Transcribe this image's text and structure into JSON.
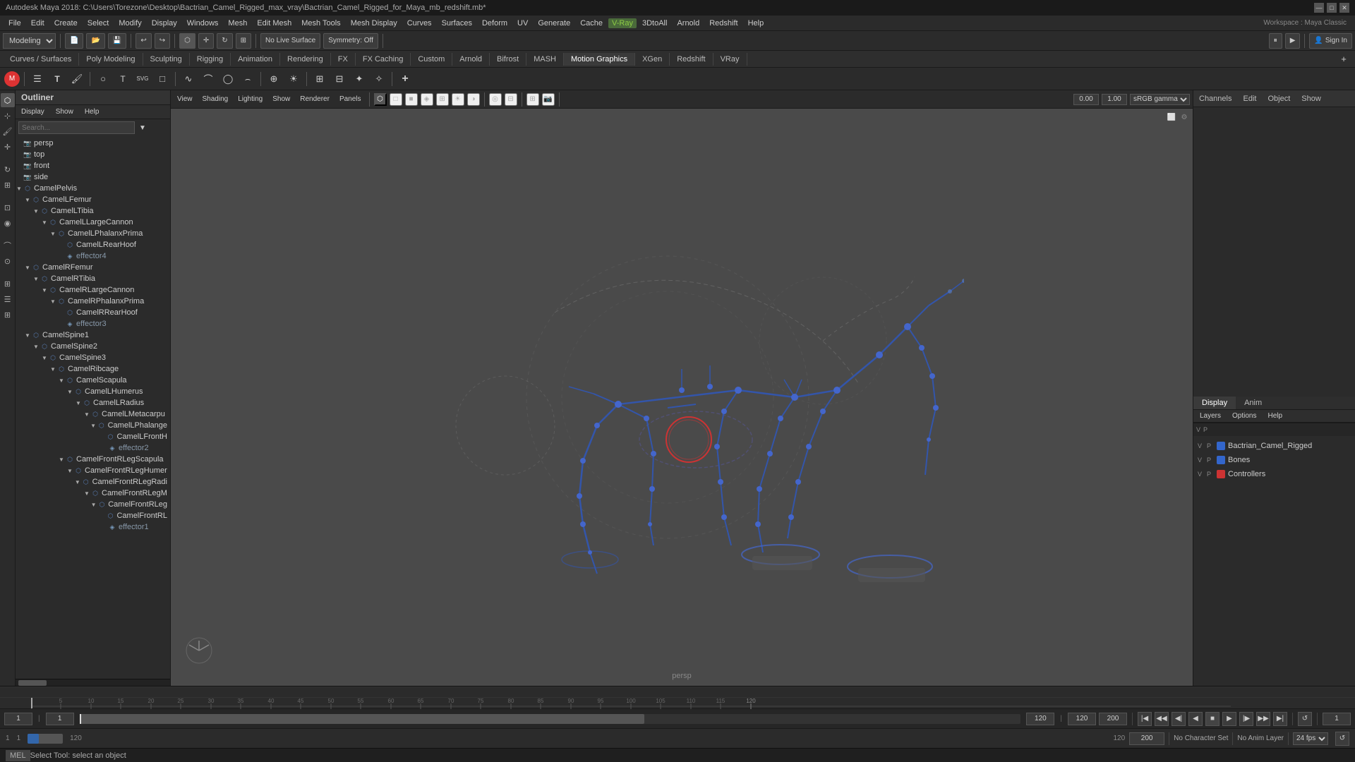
{
  "titleBar": {
    "title": "Autodesk Maya 2018: C:\\Users\\Torezone\\Desktop\\Bactrian_Camel_Rigged_max_vray\\Bactrian_Camel_Rigged_for_Maya_mb_redshift.mb*",
    "controls": [
      "—",
      "□",
      "✕"
    ]
  },
  "menuBar": {
    "items": [
      "File",
      "Edit",
      "Create",
      "Select",
      "Modify",
      "Display",
      "Windows",
      "Mesh",
      "Edit Mesh",
      "Mesh Tools",
      "Mesh Display",
      "Curves",
      "Surfaces",
      "Deform",
      "UV",
      "Generate",
      "Cache",
      "V-Ray",
      "3DtoAll",
      "Arnold",
      "Redshift",
      "Help"
    ]
  },
  "toolbar1": {
    "modeLabel": "Modeling",
    "workspaceLabel": "Workspace : Maya Classic",
    "liveSurface": "No Live Surface",
    "symmetry": "Symmetry: Off",
    "signIn": "Sign In"
  },
  "toolbar2": {
    "tabs": [
      "Curves / Surfaces",
      "Poly Modeling",
      "Sculpting",
      "Rigging",
      "Animation",
      "Rendering",
      "FX",
      "FX Caching",
      "Custom",
      "Arnold",
      "Bifrost",
      "MASH",
      "Motion Graphics",
      "XGen",
      "Redshift",
      "VRay"
    ]
  },
  "outliner": {
    "title": "Outliner",
    "menuItems": [
      "Display",
      "Show",
      "Help"
    ],
    "searchPlaceholder": "Search...",
    "items": [
      {
        "id": "persp",
        "label": "persp",
        "depth": 0,
        "type": "camera",
        "hasArrow": false
      },
      {
        "id": "top",
        "label": "top",
        "depth": 0,
        "type": "camera",
        "hasArrow": false
      },
      {
        "id": "front",
        "label": "front",
        "depth": 0,
        "type": "camera",
        "hasArrow": false
      },
      {
        "id": "side",
        "label": "side",
        "depth": 0,
        "type": "camera",
        "hasArrow": false
      },
      {
        "id": "CamelPelvis",
        "label": "CamelPelvis",
        "depth": 0,
        "type": "bone",
        "hasArrow": true
      },
      {
        "id": "CamelLFemur",
        "label": "CamelLFemur",
        "depth": 1,
        "type": "bone",
        "hasArrow": true
      },
      {
        "id": "CamelLTibia",
        "label": "CamelLTibia",
        "depth": 2,
        "type": "bone",
        "hasArrow": true
      },
      {
        "id": "CamelLLargeCannon",
        "label": "CamelLLargeCannon",
        "depth": 3,
        "type": "bone",
        "hasArrow": true
      },
      {
        "id": "CamelLPhalanxPrima",
        "label": "CamelLPhalanxPrima",
        "depth": 4,
        "type": "bone",
        "hasArrow": true
      },
      {
        "id": "CamelLRearHoof",
        "label": "CamelLRearHoof",
        "depth": 5,
        "type": "bone",
        "hasArrow": false
      },
      {
        "id": "effector4",
        "label": "effector4",
        "depth": 5,
        "type": "effector",
        "hasArrow": false
      },
      {
        "id": "CamelRFemur",
        "label": "CamelRFemur",
        "depth": 1,
        "type": "bone",
        "hasArrow": true
      },
      {
        "id": "CamelRTibia",
        "label": "CamelRTibia",
        "depth": 2,
        "type": "bone",
        "hasArrow": true
      },
      {
        "id": "CamelRLargeCannon",
        "label": "CamelRLargeCannon",
        "depth": 3,
        "type": "bone",
        "hasArrow": true
      },
      {
        "id": "CamelRPhalanxPrima",
        "label": "CamelRPhalanxPrima",
        "depth": 4,
        "type": "bone",
        "hasArrow": true
      },
      {
        "id": "CamelRRearHoof",
        "label": "CamelRRearHoof",
        "depth": 5,
        "type": "bone",
        "hasArrow": false
      },
      {
        "id": "effector3",
        "label": "effector3",
        "depth": 5,
        "type": "effector",
        "hasArrow": false
      },
      {
        "id": "CamelSpine1",
        "label": "CamelSpine1",
        "depth": 1,
        "type": "bone",
        "hasArrow": true
      },
      {
        "id": "CamelSpine2",
        "label": "CamelSpine2",
        "depth": 2,
        "type": "bone",
        "hasArrow": true
      },
      {
        "id": "CamelSpine3",
        "label": "CamelSpine3",
        "depth": 3,
        "type": "bone",
        "hasArrow": true
      },
      {
        "id": "CamelRibcage",
        "label": "CamelRibcage",
        "depth": 4,
        "type": "bone",
        "hasArrow": true
      },
      {
        "id": "CamelScapula",
        "label": "CamelScapula",
        "depth": 5,
        "type": "bone",
        "hasArrow": true
      },
      {
        "id": "CamelLHumerus",
        "label": "CamelLHumerus",
        "depth": 6,
        "type": "bone",
        "hasArrow": true
      },
      {
        "id": "CamelLRadius",
        "label": "CamelLRadius",
        "depth": 7,
        "type": "bone",
        "hasArrow": true
      },
      {
        "id": "CamelLMetacarpu",
        "label": "CamelLMetacarpu",
        "depth": 8,
        "type": "bone",
        "hasArrow": true
      },
      {
        "id": "CamelLPhalange",
        "label": "CamelLPhalange",
        "depth": 9,
        "type": "bone",
        "hasArrow": true
      },
      {
        "id": "CamelLFrontH",
        "label": "CamelLFrontH",
        "depth": 10,
        "type": "bone",
        "hasArrow": false
      },
      {
        "id": "effector2",
        "label": "effector2",
        "depth": 10,
        "type": "effector",
        "hasArrow": false
      },
      {
        "id": "CamelFrontRLegScapula",
        "label": "CamelFrontRLegScapula",
        "depth": 5,
        "type": "bone",
        "hasArrow": true
      },
      {
        "id": "CamelFrontRLegHumer",
        "label": "CamelFrontRLegHumer",
        "depth": 6,
        "type": "bone",
        "hasArrow": true
      },
      {
        "id": "CamelFrontRLegRadi",
        "label": "CamelFrontRLegRadi",
        "depth": 7,
        "type": "bone",
        "hasArrow": true
      },
      {
        "id": "CamelFrontRLegM",
        "label": "CamelFrontRLegM",
        "depth": 8,
        "type": "bone",
        "hasArrow": true
      },
      {
        "id": "CamelFrontRLeg",
        "label": "CamelFrontRLeg",
        "depth": 9,
        "type": "bone",
        "hasArrow": true
      },
      {
        "id": "CamelFrontRL",
        "label": "CamelFrontRL",
        "depth": 10,
        "type": "bone",
        "hasArrow": false
      },
      {
        "id": "effector1",
        "label": "effector1",
        "depth": 10,
        "type": "effector",
        "hasArrow": false
      }
    ]
  },
  "viewport": {
    "label": "persp",
    "menuItems": [
      "View",
      "Shading",
      "Lighting",
      "Show",
      "Renderer",
      "Panels"
    ],
    "liveSurface": "No Live Surface",
    "gamma": "sRGB gamma",
    "value1": "0.00",
    "value2": "1.00"
  },
  "rightPanel": {
    "tabs": [
      "Channels",
      "Edit",
      "Object",
      "Show"
    ],
    "layerTabs": [
      "Display",
      "Anim"
    ],
    "layerMenuItems": [
      "Layers",
      "Options",
      "Help"
    ],
    "layers": [
      {
        "id": "BacrianCamelRigged",
        "label": "Bactrian_Camel_Rigged",
        "color": "#3366cc",
        "v": "V",
        "p": "P"
      },
      {
        "id": "Bones",
        "label": "Bones",
        "color": "#3366cc",
        "v": "V",
        "p": "P"
      },
      {
        "id": "Controllers",
        "label": "Controllers",
        "color": "#cc3333",
        "v": "V",
        "p": "P"
      }
    ]
  },
  "timeline": {
    "start": "1",
    "end": "120",
    "rangeStart": "1",
    "rangeEnd": "200",
    "currentFrame": "1",
    "ticks": [
      {
        "pos": 5,
        "label": "5"
      },
      {
        "pos": 10,
        "label": "10"
      },
      {
        "pos": 15,
        "label": "15"
      },
      {
        "pos": 20,
        "label": "20"
      },
      {
        "pos": 25,
        "label": "25"
      },
      {
        "pos": 30,
        "label": "30"
      },
      {
        "pos": 35,
        "label": "35"
      },
      {
        "pos": 40,
        "label": "40"
      },
      {
        "pos": 45,
        "label": "45"
      },
      {
        "pos": 50,
        "label": "50"
      },
      {
        "pos": 55,
        "label": "55"
      },
      {
        "pos": 60,
        "label": "60"
      },
      {
        "pos": 65,
        "label": "65"
      },
      {
        "pos": 70,
        "label": "70"
      },
      {
        "pos": 75,
        "label": "75"
      },
      {
        "pos": 80,
        "label": "80"
      },
      {
        "pos": 85,
        "label": "85"
      },
      {
        "pos": 90,
        "label": "90"
      },
      {
        "pos": 95,
        "label": "95"
      },
      {
        "pos": 100,
        "label": "100"
      },
      {
        "pos": 105,
        "label": "105"
      },
      {
        "pos": 110,
        "label": "110"
      },
      {
        "pos": 115,
        "label": "115"
      },
      {
        "pos": 120,
        "label": "120"
      }
    ]
  },
  "transport": {
    "currentFrame": "1",
    "startFrame": "1",
    "endFrame": "120",
    "rangeEnd": "200",
    "noCharacter": "No Character Set",
    "noAnimLayer": "No Anim Layer",
    "fps": "24 fps",
    "playBtn": "▶",
    "stopBtn": "■",
    "prevBtn": "⏮",
    "nextBtn": "⏭",
    "prevKeyBtn": "◀",
    "nextKeyBtn": "▶",
    "loopBtn": "↺"
  },
  "statusBar": {
    "mel": "MEL",
    "text": "Select Tool: select an object"
  },
  "icons": {
    "search": "🔍",
    "camera": "📷",
    "bone": "🦴",
    "gear": "⚙",
    "lock": "🔒",
    "eye": "👁",
    "arrow_right": "▶",
    "arrow_down": "▼",
    "arrow_left": "◀",
    "close": "✕",
    "minimize": "—",
    "maximize": "□"
  }
}
